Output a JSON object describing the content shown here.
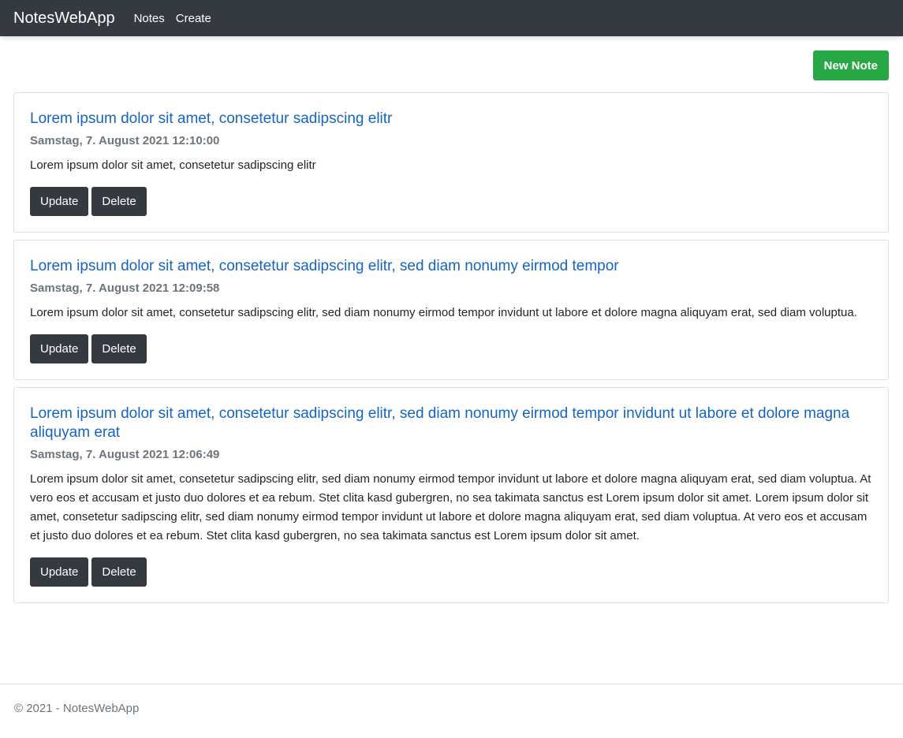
{
  "navbar": {
    "brand": "NotesWebApp",
    "links": [
      "Notes",
      "Create"
    ]
  },
  "toolbar": {
    "new_note_label": "New Note"
  },
  "notes": [
    {
      "title": "Lorem ipsum dolor sit amet, consetetur sadipscing elitr",
      "date": "Samstag, 7. August 2021 12:10:00",
      "body": "Lorem ipsum dolor sit amet, consetetur sadipscing elitr",
      "update_label": "Update",
      "delete_label": "Delete"
    },
    {
      "title": "Lorem ipsum dolor sit amet, consetetur sadipscing elitr, sed diam nonumy eirmod tempor",
      "date": "Samstag, 7. August 2021 12:09:58",
      "body": "Lorem ipsum dolor sit amet, consetetur sadipscing elitr, sed diam nonumy eirmod tempor invidunt ut labore et dolore magna aliquyam erat, sed diam voluptua.",
      "update_label": "Update",
      "delete_label": "Delete"
    },
    {
      "title": "Lorem ipsum dolor sit amet, consetetur sadipscing elitr, sed diam nonumy eirmod tempor invidunt ut labore et dolore magna aliquyam erat",
      "date": "Samstag, 7. August 2021 12:06:49",
      "body": "Lorem ipsum dolor sit amet, consetetur sadipscing elitr, sed diam nonumy eirmod tempor invidunt ut labore et dolore magna aliquyam erat, sed diam voluptua. At vero eos et accusam et justo duo dolores et ea rebum. Stet clita kasd gubergren, no sea takimata sanctus est Lorem ipsum dolor sit amet. Lorem ipsum dolor sit amet, consetetur sadipscing elitr, sed diam nonumy eirmod tempor invidunt ut labore et dolore magna aliquyam erat, sed diam voluptua. At vero eos et accusam et justo duo dolores et ea rebum. Stet clita kasd gubergren, no sea takimata sanctus est Lorem ipsum dolor sit amet.",
      "update_label": "Update",
      "delete_label": "Delete"
    }
  ],
  "footer": {
    "text": "© 2021 - NotesWebApp"
  },
  "colors": {
    "navbar": "#343a40",
    "success": "#28a745",
    "link": "#1565c0",
    "muted": "#6c757d"
  }
}
